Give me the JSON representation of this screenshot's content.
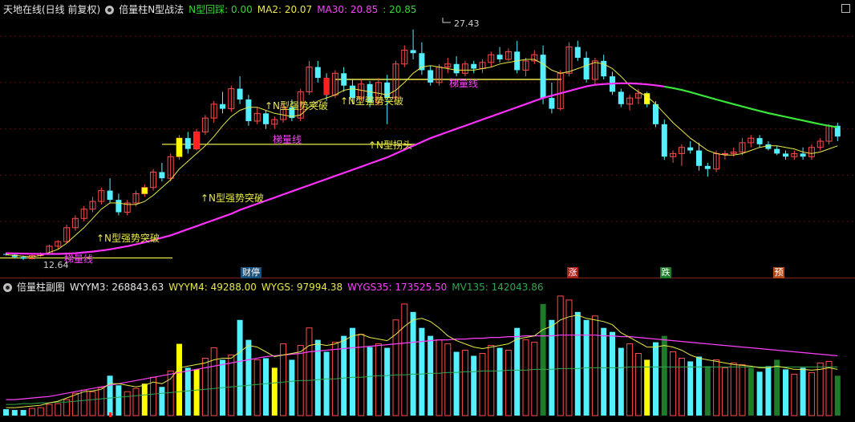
{
  "main_header": {
    "title": "天地在线(日线 前复权)",
    "indicator": "倍量柱N型战法",
    "n_label": "N型回踩:",
    "n_value": "0.00",
    "ma2_label": "MA2:",
    "ma2_value": "20.07",
    "ma30_label": "MA30:",
    "ma30_value": "20.85",
    "ma30_extra": ": 20.85"
  },
  "sub_header": {
    "title": "倍量柱副图",
    "wyym3": "WYYM3: 268843.63",
    "wyym4": "WYYM4: 49288.00",
    "wygs": "WYGS: 97994.38",
    "wygs35": "WYGS35: 173525.50",
    "mv135": "MV135: 142043.86"
  },
  "price_labels": {
    "high": "27.43",
    "low": "12.64"
  },
  "annotations": [
    {
      "text": "↑N型强势突破",
      "color": "#e8e84a"
    },
    {
      "text": "↑N型强势突破",
      "color": "#e8e84a"
    },
    {
      "text": "↑N型强势突破",
      "color": "#e8e84a"
    },
    {
      "text": "↑N型强势突破",
      "color": "#e8e84a"
    },
    {
      "text": "↑N型拐头",
      "color": "#e8e84a"
    },
    {
      "text": "梯量线",
      "color": "#ff40ff"
    },
    {
      "text": "梯量线",
      "color": "#ff40ff"
    },
    {
      "text": "梯量线",
      "color": "#ff40ff"
    }
  ],
  "events": [
    {
      "text": "财停",
      "bg": "#1a4f7a"
    },
    {
      "text": "涨",
      "bg": "#a8201a"
    },
    {
      "text": "跌",
      "bg": "#1f7a2a"
    },
    {
      "text": "预",
      "bg": "#b3471a"
    }
  ],
  "colors": {
    "up": "#ff4b4b",
    "down": "#55f0ff",
    "ma_short": "#e8e84a",
    "ma_long": "#ff30ff",
    "ma_long2": "#39e639",
    "grid": "#5a0f0f"
  },
  "candles": [
    [
      12.9,
      13.0,
      12.8,
      12.85
    ],
    [
      12.85,
      12.9,
      12.6,
      12.7
    ],
    [
      12.7,
      12.8,
      12.5,
      12.6
    ],
    [
      12.6,
      12.9,
      12.55,
      12.8
    ],
    [
      12.8,
      13.0,
      12.7,
      12.9
    ],
    [
      12.9,
      13.5,
      12.85,
      13.4
    ],
    [
      13.4,
      13.8,
      13.2,
      13.7
    ],
    [
      13.7,
      14.8,
      13.6,
      14.6
    ],
    [
      14.6,
      15.4,
      14.4,
      15.2
    ],
    [
      15.2,
      16.0,
      15.0,
      15.8
    ],
    [
      15.8,
      16.6,
      15.6,
      16.3
    ],
    [
      16.3,
      17.2,
      16.1,
      17.0
    ],
    [
      17.0,
      17.8,
      16.2,
      16.4
    ],
    [
      16.4,
      16.8,
      15.4,
      15.6
    ],
    [
      15.6,
      16.4,
      15.4,
      16.2
    ],
    [
      16.2,
      17.0,
      16.0,
      16.8
    ],
    [
      16.8,
      17.4,
      16.6,
      17.2
    ],
    [
      17.2,
      18.4,
      17.0,
      18.2
    ],
    [
      18.2,
      18.8,
      17.6,
      17.8
    ],
    [
      17.8,
      19.4,
      17.6,
      19.2
    ],
    [
      19.2,
      20.6,
      19.0,
      20.4
    ],
    [
      20.4,
      20.8,
      19.4,
      19.7
    ],
    [
      19.7,
      21.0,
      19.6,
      20.8
    ],
    [
      20.8,
      21.9,
      20.6,
      21.7
    ],
    [
      21.7,
      22.8,
      21.4,
      22.6
    ],
    [
      22.6,
      23.4,
      22.0,
      22.3
    ],
    [
      22.3,
      23.8,
      22.1,
      23.6
    ],
    [
      23.6,
      24.4,
      22.6,
      22.9
    ],
    [
      22.9,
      23.2,
      21.2,
      21.5
    ],
    [
      21.5,
      22.4,
      21.3,
      22.0
    ],
    [
      22.0,
      22.2,
      21.0,
      21.3
    ],
    [
      21.3,
      21.8,
      21.0,
      21.6
    ],
    [
      21.6,
      22.6,
      21.4,
      22.4
    ],
    [
      22.4,
      22.9,
      21.5,
      21.7
    ],
    [
      21.7,
      23.6,
      21.5,
      23.4
    ],
    [
      23.4,
      25.4,
      23.2,
      25.0
    ],
    [
      25.0,
      25.4,
      24.0,
      24.3
    ],
    [
      24.3,
      24.6,
      22.8,
      23.2
    ],
    [
      23.2,
      24.8,
      23.0,
      24.6
    ],
    [
      24.6,
      25.0,
      23.4,
      23.8
    ],
    [
      23.8,
      24.2,
      22.6,
      23.0
    ],
    [
      23.0,
      24.2,
      22.8,
      23.9
    ],
    [
      23.9,
      24.1,
      22.4,
      22.7
    ],
    [
      22.7,
      24.3,
      22.5,
      24.0
    ],
    [
      24.0,
      24.5,
      21.3,
      23.0
    ],
    [
      23.0,
      25.4,
      22.9,
      25.2
    ],
    [
      25.2,
      26.4,
      25.0,
      26.1
    ],
    [
      26.1,
      27.43,
      25.5,
      25.9
    ],
    [
      25.9,
      26.6,
      24.5,
      24.8
    ],
    [
      24.8,
      25.1,
      23.8,
      24.0
    ],
    [
      24.0,
      25.2,
      23.8,
      25.0
    ],
    [
      25.0,
      25.6,
      24.6,
      25.2
    ],
    [
      25.2,
      25.7,
      24.4,
      24.6
    ],
    [
      24.6,
      25.4,
      24.4,
      25.2
    ],
    [
      25.2,
      25.4,
      24.6,
      24.9
    ],
    [
      24.9,
      25.5,
      24.6,
      25.3
    ],
    [
      25.3,
      26.0,
      25.0,
      25.8
    ],
    [
      25.8,
      26.3,
      25.3,
      25.5
    ],
    [
      25.5,
      26.2,
      25.4,
      26.0
    ],
    [
      26.0,
      26.7,
      24.6,
      24.8
    ],
    [
      24.8,
      25.6,
      24.4,
      25.4
    ],
    [
      25.4,
      26.1,
      25.2,
      25.8
    ],
    [
      25.8,
      26.4,
      22.6,
      23.0
    ],
    [
      23.0,
      24.0,
      22.0,
      22.3
    ],
    [
      22.3,
      24.8,
      22.2,
      24.6
    ],
    [
      24.6,
      26.6,
      24.4,
      26.3
    ],
    [
      26.3,
      26.7,
      25.4,
      25.6
    ],
    [
      25.6,
      26.0,
      24.0,
      24.2
    ],
    [
      24.2,
      25.6,
      23.8,
      25.4
    ],
    [
      25.4,
      25.8,
      24.2,
      24.4
    ],
    [
      24.4,
      24.7,
      23.2,
      23.4
    ],
    [
      23.4,
      23.6,
      22.4,
      22.6
    ],
    [
      22.6,
      23.2,
      22.2,
      23.0
    ],
    [
      23.0,
      23.6,
      22.6,
      23.3
    ],
    [
      23.3,
      23.4,
      22.4,
      22.6
    ],
    [
      22.6,
      22.8,
      21.1,
      21.3
    ],
    [
      21.3,
      21.6,
      19.0,
      19.2
    ],
    [
      19.2,
      19.6,
      18.8,
      19.4
    ],
    [
      19.4,
      20.0,
      18.6,
      19.8
    ],
    [
      19.8,
      20.2,
      19.4,
      19.6
    ],
    [
      19.6,
      20.1,
      18.3,
      18.6
    ],
    [
      18.6,
      18.8,
      17.9,
      18.4
    ],
    [
      18.4,
      19.6,
      18.2,
      19.4
    ],
    [
      19.4,
      19.6,
      19.0,
      19.4
    ],
    [
      19.4,
      19.8,
      19.2,
      19.5
    ],
    [
      19.5,
      20.4,
      19.3,
      20.1
    ],
    [
      20.1,
      20.6,
      19.8,
      20.4
    ],
    [
      20.4,
      20.6,
      19.8,
      20.0
    ],
    [
      20.0,
      20.2,
      19.6,
      19.7
    ],
    [
      19.7,
      19.9,
      19.3,
      19.4
    ],
    [
      19.4,
      19.6,
      19.0,
      19.2
    ],
    [
      19.2,
      19.6,
      19.0,
      19.4
    ],
    [
      19.4,
      19.8,
      19.0,
      19.2
    ],
    [
      19.2,
      20.0,
      19.0,
      19.8
    ],
    [
      19.8,
      20.4,
      19.6,
      20.2
    ],
    [
      20.2,
      21.3,
      20.0,
      21.2
    ],
    [
      21.2,
      21.4,
      20.2,
      20.5
    ]
  ],
  "volumes": [
    8,
    7,
    7,
    9,
    10,
    14,
    15,
    20,
    28,
    32,
    30,
    35,
    50,
    38,
    30,
    34,
    40,
    48,
    36,
    56,
    90,
    60,
    58,
    72,
    85,
    70,
    76,
    120,
    95,
    70,
    72,
    60,
    90,
    70,
    88,
    110,
    95,
    80,
    92,
    100,
    110,
    102,
    86,
    90,
    85,
    120,
    140,
    130,
    110,
    100,
    95,
    90,
    80,
    82,
    75,
    78,
    88,
    85,
    82,
    110,
    95,
    92,
    140,
    120,
    150,
    145,
    130,
    120,
    125,
    110,
    105,
    85,
    90,
    78,
    70,
    92,
    100,
    80,
    72,
    68,
    74,
    62,
    70,
    60,
    66,
    64,
    60,
    55,
    62,
    70,
    58,
    52,
    60,
    54,
    66,
    68,
    50
  ],
  "ma_short": [
    12.85,
    12.8,
    12.75,
    12.72,
    12.8,
    13.0,
    13.2,
    13.6,
    14.1,
    14.6,
    15.2,
    15.8,
    16.2,
    16.2,
    16.1,
    16.1,
    16.3,
    16.7,
    17.2,
    17.7,
    18.4,
    18.9,
    19.4,
    19.9,
    20.5,
    21.2,
    21.8,
    22.2,
    22.4,
    22.4,
    22.2,
    22.0,
    21.9,
    21.8,
    21.9,
    22.4,
    22.8,
    23.0,
    23.2,
    23.5,
    23.6,
    23.5,
    23.4,
    23.3,
    23.2,
    23.5,
    24.0,
    24.6,
    25.0,
    25.1,
    25.0,
    24.9,
    24.8,
    24.8,
    24.8,
    24.9,
    25.0,
    25.2,
    25.3,
    25.4,
    25.5,
    25.5,
    25.2,
    24.8,
    24.6,
    24.7,
    24.9,
    25.1,
    25.3,
    25.2,
    24.9,
    24.4,
    23.8,
    23.4,
    23.1,
    22.6,
    22.0,
    21.4,
    20.9,
    20.4,
    20.0,
    19.6,
    19.4,
    19.3,
    19.3,
    19.4,
    19.6,
    19.8,
    19.9,
    19.9,
    19.8,
    19.7,
    19.5,
    19.4,
    19.5,
    19.7,
    19.9
  ],
  "ma_long": [
    12.95,
    12.93,
    12.92,
    12.91,
    12.9,
    12.9,
    12.9,
    12.92,
    12.95,
    13.0,
    13.05,
    13.12,
    13.2,
    13.3,
    13.4,
    13.52,
    13.65,
    13.8,
    13.95,
    14.1,
    14.3,
    14.5,
    14.7,
    14.9,
    15.1,
    15.3,
    15.5,
    15.75,
    15.95,
    16.15,
    16.35,
    16.55,
    16.75,
    16.95,
    17.15,
    17.35,
    17.55,
    17.75,
    17.95,
    18.15,
    18.35,
    18.55,
    18.75,
    18.95,
    19.15,
    19.4,
    19.65,
    19.9,
    20.15,
    20.4,
    20.6,
    20.8,
    21.0,
    21.2,
    21.4,
    21.6,
    21.8,
    22.0,
    22.2,
    22.4,
    22.6,
    22.8,
    23.0,
    23.15,
    23.3,
    23.45,
    23.6,
    23.75,
    23.85,
    23.9,
    23.93,
    23.95,
    23.95,
    23.92,
    23.88,
    23.82,
    23.74,
    23.64,
    23.52,
    23.38,
    23.22,
    23.06,
    22.9,
    22.75,
    22.6,
    22.45,
    22.3,
    22.16,
    22.02,
    21.9,
    21.78,
    21.66,
    21.54,
    21.42,
    21.3,
    21.2,
    21.1
  ],
  "sub_lines": {
    "yellow": [
      10,
      10,
      11,
      12,
      13,
      16,
      18,
      22,
      26,
      30,
      31,
      33,
      40,
      40,
      38,
      36,
      38,
      42,
      40,
      46,
      60,
      62,
      64,
      66,
      70,
      72,
      72,
      80,
      88,
      86,
      80,
      74,
      76,
      78,
      80,
      88,
      90,
      88,
      90,
      94,
      100,
      102,
      98,
      96,
      94,
      102,
      112,
      120,
      122,
      118,
      110,
      100,
      94,
      90,
      86,
      84,
      86,
      88,
      90,
      96,
      98,
      100,
      108,
      112,
      120,
      124,
      126,
      122,
      120,
      118,
      114,
      104,
      98,
      92,
      86,
      86,
      88,
      86,
      82,
      76,
      72,
      70,
      68,
      66,
      64,
      63,
      62,
      60,
      60,
      62,
      60,
      58,
      58,
      57,
      58,
      60,
      58
    ],
    "magenta": [
      20,
      20,
      21,
      22,
      23,
      24,
      26,
      28,
      30,
      32,
      34,
      36,
      38,
      40,
      42,
      44,
      46,
      48,
      50,
      52,
      54,
      56,
      58,
      60,
      62,
      64,
      66,
      68,
      70,
      72,
      74,
      75,
      76,
      77,
      78,
      80,
      81,
      82,
      83,
      84,
      85,
      86,
      87,
      88,
      89,
      90,
      91,
      92,
      93,
      94,
      95,
      95,
      96,
      96,
      97,
      97,
      98,
      98,
      99,
      99,
      100,
      100,
      100,
      100,
      101,
      101,
      101,
      101,
      101,
      100,
      100,
      99,
      99,
      98,
      97,
      96,
      95,
      94,
      93,
      92,
      91,
      90,
      89,
      88,
      87,
      86,
      85,
      84,
      83,
      82,
      81,
      80,
      79,
      78,
      77,
      76,
      75
    ],
    "green": [
      14,
      14,
      15,
      15,
      16,
      16,
      17,
      17,
      18,
      19,
      20,
      21,
      22,
      23,
      24,
      25,
      26,
      27,
      28,
      29,
      30,
      31,
      32,
      33,
      34,
      35,
      36,
      37,
      38,
      39,
      40,
      41,
      42,
      43,
      44,
      44,
      45,
      46,
      46,
      47,
      48,
      48,
      49,
      50,
      50,
      51,
      51,
      52,
      52,
      53,
      53,
      54,
      54,
      55,
      55,
      56,
      56,
      56,
      57,
      57,
      57,
      58,
      58,
      58,
      59,
      59,
      59,
      60,
      60,
      60,
      60,
      60,
      61,
      61,
      61,
      61,
      61,
      61,
      61,
      61,
      61,
      61,
      61,
      61,
      61,
      61,
      61,
      61,
      61,
      61,
      61,
      61,
      61,
      61,
      61,
      61,
      61
    ]
  }
}
